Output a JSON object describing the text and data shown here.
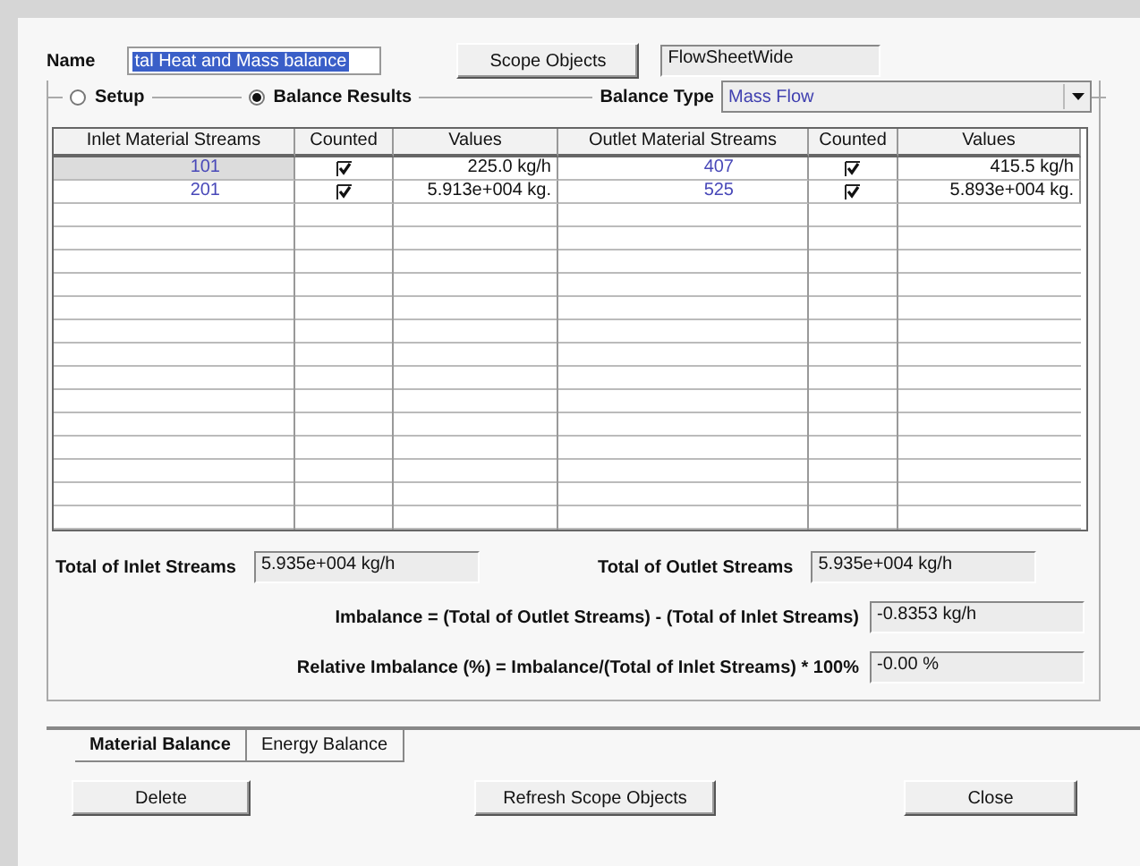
{
  "name_field": {
    "label": "Name",
    "value": "tal Heat and Mass balance"
  },
  "scope_button": "Scope Objects",
  "scope_field": "FlowSheetWide",
  "modes": [
    {
      "label": "Setup",
      "selected": false
    },
    {
      "label": "Balance Results",
      "selected": true
    }
  ],
  "balance_type": {
    "label": "Balance Type",
    "value": "Mass Flow"
  },
  "table": {
    "columns": [
      "Inlet Material Streams",
      "Counted",
      "Values",
      "Outlet Material Streams",
      "Counted",
      "Values"
    ],
    "rows": [
      {
        "inlet": "101",
        "inlet_counted": true,
        "inlet_value": "225.0 kg/h",
        "outlet": "407",
        "outlet_counted": true,
        "outlet_value": "415.5 kg/h",
        "selected": true
      },
      {
        "inlet": "201",
        "inlet_counted": true,
        "inlet_value": "5.913e+004 kg.",
        "outlet": "525",
        "outlet_counted": true,
        "outlet_value": "5.893e+004 kg.",
        "selected": false
      }
    ]
  },
  "totals": {
    "inlet": {
      "label": "Total of Inlet Streams",
      "value": "5.935e+004 kg/h"
    },
    "outlet": {
      "label": "Total of Outlet Streams",
      "value": "5.935e+004 kg/h"
    },
    "imbalance": {
      "label": "Imbalance = (Total of Outlet Streams) - (Total of Inlet Streams)",
      "value": "-0.8353 kg/h"
    },
    "relative": {
      "label": "Relative Imbalance (%) = Imbalance/(Total of Inlet Streams) * 100%",
      "value": "-0.00 %"
    }
  },
  "tabs": [
    {
      "label": "Material Balance",
      "selected": true
    },
    {
      "label": "Energy Balance",
      "selected": false
    }
  ],
  "buttons": [
    "Delete",
    "Refresh Scope Objects",
    "Close"
  ]
}
